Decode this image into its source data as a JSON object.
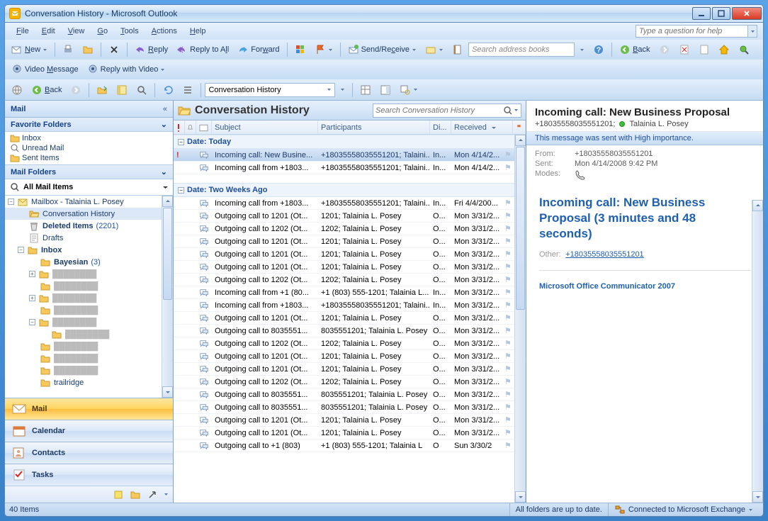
{
  "window_title": "Conversation History - Microsoft Outlook",
  "menu": [
    "File",
    "Edit",
    "View",
    "Go",
    "Tools",
    "Actions",
    "Help"
  ],
  "help_placeholder": "Type a question for help",
  "tb1": {
    "new": "New",
    "reply": "Reply",
    "replyall": "Reply to All",
    "forward": "Forward",
    "sendrecv": "Send/Receive",
    "search_placeholder": "Search address books",
    "back": "Back"
  },
  "tb2": {
    "videomsg": "Video Message",
    "replyvideo": "Reply with Video"
  },
  "tb3": {
    "back": "Back",
    "combo": "Conversation History"
  },
  "nav": {
    "header": "Mail",
    "fav_header": "Favorite Folders",
    "favs": [
      "Inbox",
      "Unread Mail",
      "Sent Items"
    ],
    "mail_header": "Mail Folders",
    "allmail": "All Mail Items",
    "tree": [
      {
        "d": 0,
        "exp": "-",
        "ico": "mailbox",
        "txt": "Mailbox - Talainia L. Posey"
      },
      {
        "d": 1,
        "ico": "folder-open",
        "txt": "Conversation History",
        "sel": true
      },
      {
        "d": 1,
        "ico": "trash",
        "txt": "Deleted Items",
        "bold": true,
        "count": "(2201)"
      },
      {
        "d": 1,
        "ico": "draft",
        "txt": "Drafts"
      },
      {
        "d": 1,
        "exp": "-",
        "ico": "inbox",
        "txt": "Inbox",
        "bold": true
      },
      {
        "d": 2,
        "ico": "folder",
        "txt": "Bayesian",
        "bold": true,
        "count": "(3)"
      },
      {
        "d": 2,
        "exp": "+",
        "ico": "folder",
        "txt": "",
        "blur": true
      },
      {
        "d": 2,
        "ico": "folder",
        "txt": "",
        "blur": true
      },
      {
        "d": 2,
        "exp": "+",
        "ico": "folder",
        "txt": "",
        "blur": true
      },
      {
        "d": 2,
        "ico": "folder",
        "txt": "",
        "blur": true
      },
      {
        "d": 2,
        "exp": "-",
        "ico": "folder",
        "txt": "",
        "blur": true
      },
      {
        "d": 3,
        "ico": "folder",
        "txt": "",
        "blur": true
      },
      {
        "d": 2,
        "ico": "folder",
        "txt": "",
        "blur": true
      },
      {
        "d": 2,
        "ico": "folder",
        "txt": "",
        "blur": true
      },
      {
        "d": 2,
        "ico": "folder",
        "txt": "",
        "blur": true
      },
      {
        "d": 2,
        "ico": "folder",
        "txt": "trailridge"
      }
    ],
    "big": [
      "Mail",
      "Calendar",
      "Contacts",
      "Tasks"
    ]
  },
  "list": {
    "title": "Conversation History",
    "search_placeholder": "Search Conversation History",
    "columns": {
      "subject": "Subject",
      "participants": "Participants",
      "di": "Di...",
      "received": "Received"
    },
    "groups": [
      {
        "label": "Date: Today",
        "items": [
          {
            "imp": true,
            "subj": "Incoming call: New Busine...",
            "part": "+18035558035551201; Talaini...",
            "di": "In...",
            "recv": "Mon 4/14/2...",
            "sel": true
          },
          {
            "subj": "Incoming call from +1803...",
            "part": "+18035558035551201; Talaini...",
            "di": "In...",
            "recv": "Mon 4/14/2..."
          }
        ]
      },
      {
        "label": "Date: Two Weeks Ago",
        "items": [
          {
            "subj": "Incoming call from +1803...",
            "part": "+18035558035551201; Talaini...",
            "di": "In...",
            "recv": "Fri 4/4/200..."
          },
          {
            "subj": "Outgoing call to 1201 (Ot...",
            "part": "1201; Talainia L. Posey",
            "di": "O...",
            "recv": "Mon 3/31/2..."
          },
          {
            "subj": "Outgoing call to 1202 (Ot...",
            "part": "1202; Talainia L. Posey",
            "di": "O...",
            "recv": "Mon 3/31/2..."
          },
          {
            "subj": "Outgoing call to 1201 (Ot...",
            "part": "1201; Talainia L. Posey",
            "di": "O...",
            "recv": "Mon 3/31/2..."
          },
          {
            "subj": "Outgoing call to 1201 (Ot...",
            "part": "1201; Talainia L. Posey",
            "di": "O...",
            "recv": "Mon 3/31/2..."
          },
          {
            "subj": "Outgoing call to 1201 (Ot...",
            "part": "1201; Talainia L. Posey",
            "di": "O...",
            "recv": "Mon 3/31/2..."
          },
          {
            "subj": "Outgoing call to 1202 (Ot...",
            "part": "1202; Talainia L. Posey",
            "di": "O...",
            "recv": "Mon 3/31/2..."
          },
          {
            "subj": "Incoming call from +1 (80...",
            "part": "+1 (803) 555-1201; Talainia L...",
            "di": "In...",
            "recv": "Mon 3/31/2..."
          },
          {
            "subj": "Incoming call from +1803...",
            "part": "+18035558035551201; Talaini...",
            "di": "In...",
            "recv": "Mon 3/31/2..."
          },
          {
            "subj": "Outgoing call to 1201 (Ot...",
            "part": "1201; Talainia L. Posey",
            "di": "O...",
            "recv": "Mon 3/31/2..."
          },
          {
            "subj": "Outgoing call to 8035551...",
            "part": "8035551201; Talainia L. Posey",
            "di": "O...",
            "recv": "Mon 3/31/2..."
          },
          {
            "subj": "Outgoing call to 1202 (Ot...",
            "part": "1202; Talainia L. Posey",
            "di": "O...",
            "recv": "Mon 3/31/2..."
          },
          {
            "subj": "Outgoing call to 1201 (Ot...",
            "part": "1201; Talainia L. Posey",
            "di": "O...",
            "recv": "Mon 3/31/2..."
          },
          {
            "subj": "Outgoing call to 1201 (Ot...",
            "part": "1201; Talainia L. Posey",
            "di": "O...",
            "recv": "Mon 3/31/2..."
          },
          {
            "subj": "Outgoing call to 1202 (Ot...",
            "part": "1202; Talainia L. Posey",
            "di": "O...",
            "recv": "Mon 3/31/2..."
          },
          {
            "subj": "Outgoing call to 8035551...",
            "part": "8035551201; Talainia L. Posey",
            "di": "O...",
            "recv": "Mon 3/31/2..."
          },
          {
            "subj": "Outgoing call to 8035551...",
            "part": "8035551201; Talainia L. Posey",
            "di": "O...",
            "recv": "Mon 3/31/2..."
          },
          {
            "subj": "Outgoing call to 1201 (Ot...",
            "part": "1201; Talainia L. Posey",
            "di": "O...",
            "recv": "Mon 3/31/2..."
          },
          {
            "subj": "Outgoing call to 1201 (Ot...",
            "part": "1201; Talainia L. Posey",
            "di": "O...",
            "recv": "Mon 3/31/2..."
          },
          {
            "subj": "Outgoing call to +1 (803)",
            "part": "+1 (803) 555-1201; Talainia L",
            "di": "O",
            "recv": "Sun 3/30/2"
          }
        ]
      }
    ]
  },
  "read": {
    "title": "Incoming call: New Business Proposal",
    "from_number": "+18035558035551201;",
    "from_name": "Talainia L. Posey",
    "infobar": "This message was sent with High importance.",
    "meta_from": "+18035558035551201",
    "meta_sent": "Mon 4/14/2008 9:42 PM",
    "meta_from_lbl": "From:",
    "meta_sent_lbl": "Sent:",
    "meta_modes_lbl": "Modes:",
    "body_title": "Incoming call: New Business Proposal (3 minutes and 48 seconds)",
    "other_lbl": "Other:",
    "other_link": "+18035558035551201",
    "sig": "Microsoft Office Communicator 2007"
  },
  "status": {
    "items": "40 Items",
    "sync": "All folders are up to date.",
    "conn": "Connected to Microsoft Exchange"
  }
}
